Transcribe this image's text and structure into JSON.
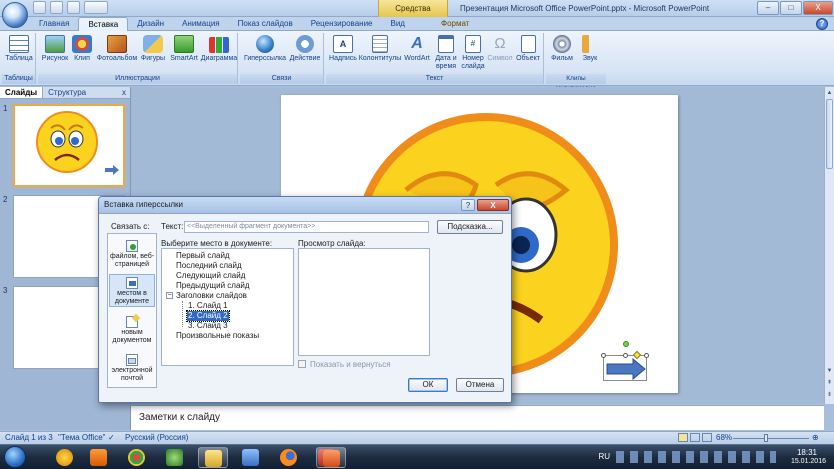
{
  "window": {
    "title": "Презентация Microsoft Office PowerPoint.pptx - Microsoft PowerPoint",
    "context_tab_group": "Средства рисования",
    "controls": [
      "–",
      "□",
      "X"
    ]
  },
  "ribbon_tabs": [
    "Главная",
    "Вставка",
    "Дизайн",
    "Анимация",
    "Показ слайдов",
    "Рецензирование",
    "Вид",
    "Формат"
  ],
  "ribbon_active_tab": "Вставка",
  "ribbon_groups": {
    "tables": {
      "label": "Таблицы",
      "buttons": [
        "Таблица"
      ]
    },
    "illustrations": {
      "label": "Иллюстрации",
      "buttons": [
        "Рисунок",
        "Клип",
        "Фотоальбом",
        "Фигуры",
        "SmartArt",
        "Диаграмма"
      ]
    },
    "links": {
      "label": "Связи",
      "buttons": [
        "Гиперссылка",
        "Действие"
      ]
    },
    "text": {
      "label": "Текст",
      "buttons": [
        "Надпись",
        "Колонтитулы",
        "WordArt",
        "Дата и время",
        "Номер слайда",
        "Символ",
        "Объект"
      ]
    },
    "media": {
      "label": "Клипы мультимедиа",
      "buttons": [
        "Фильм",
        "Звук"
      ]
    }
  },
  "left_pane": {
    "tabs": [
      "Слайды",
      "Структура"
    ],
    "close": "x",
    "slide_numbers": [
      "1",
      "2",
      "3"
    ]
  },
  "notes_placeholder": "Заметки к слайду",
  "status": {
    "slide_info": "Слайд 1 из 3",
    "theme": "\"Тема Office\"",
    "language": "Русский (Россия)",
    "zoom": "68%",
    "zoom_fraction": 0.44
  },
  "dialog": {
    "title": "Вставка гиперссылки",
    "link_to_label": "Связать с:",
    "link_options": [
      "файлом, веб-страницей",
      "местом в документе",
      "новым документом",
      "электронной почтой"
    ],
    "selected_link_option": 1,
    "text_label": "Текст:",
    "text_value": "<<Выделенный фрагмент документа>>",
    "tooltip_button": "Подсказка...",
    "place_label": "Выберите место в документе:",
    "tree": [
      {
        "label": "Первый слайд",
        "level": 0
      },
      {
        "label": "Последний слайд",
        "level": 0
      },
      {
        "label": "Следующий слайд",
        "level": 0
      },
      {
        "label": "Предыдущий слайд",
        "level": 0
      },
      {
        "label": "Заголовки слайдов",
        "level": 0,
        "expander": "−"
      },
      {
        "label": "1. Слайд 1",
        "level": 1
      },
      {
        "label": "2. Слайд 2",
        "level": 1,
        "selected": true
      },
      {
        "label": "3. Слайд 3",
        "level": 1
      },
      {
        "label": "Произвольные показы",
        "level": 0
      }
    ],
    "preview_label": "Просмотр слайда:",
    "show_and_return": "Показать и вернуться",
    "ok": "ОК",
    "cancel": "Отмена"
  },
  "taskbar": {
    "language": "RU",
    "time": "18:31",
    "date": "15.01.2016"
  },
  "colors": {
    "accent": "#15428b",
    "selection": "#3169c6",
    "slide_thumb_selected": "#f2a93b",
    "smiley_face": "#fbd31f",
    "smiley_outline": "#f08c1a"
  }
}
